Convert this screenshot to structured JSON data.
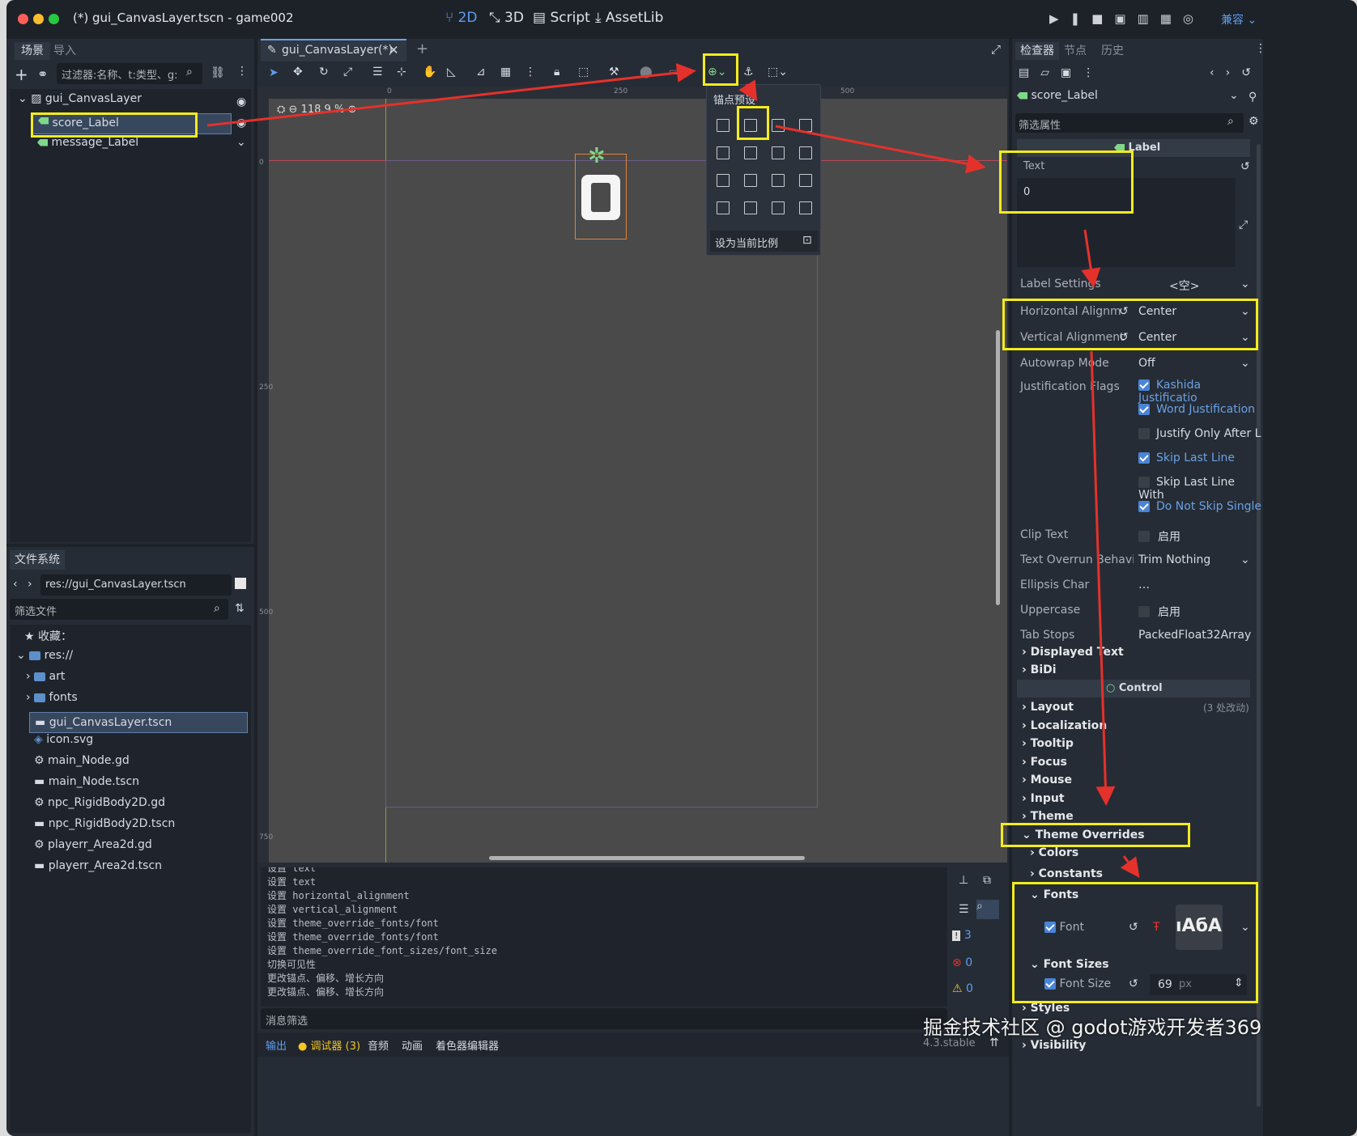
{
  "window": {
    "title": "(*) gui_CanvasLayer.tscn - game002"
  },
  "main_tabs": [
    {
      "label": "2D"
    },
    {
      "label": "3D"
    },
    {
      "label": "Script"
    },
    {
      "label": "AssetLib"
    }
  ],
  "top_right": {
    "renderer": "兼容"
  },
  "scene_dock": {
    "tabs": [
      "场景",
      "导入"
    ],
    "filter_placeholder": "过滤器:名称、t:类型、g:",
    "nodes": [
      {
        "name": "gui_CanvasLayer"
      },
      {
        "name": "score_Label"
      },
      {
        "name": "message_Label"
      }
    ]
  },
  "fs_dock": {
    "tab": "文件系统",
    "path": "res://gui_CanvasLayer.tscn",
    "filter_placeholder": "筛选文件",
    "favorites": "收藏：",
    "items": [
      "res://",
      "art",
      "fonts",
      "gui_CanvasLayer.tscn",
      "icon.svg",
      "main_Node.gd",
      "main_Node.tscn",
      "npc_RigidBody2D.gd",
      "npc_RigidBody2D.tscn",
      "playerr_Area2d.gd",
      "playerr_Area2d.tscn"
    ]
  },
  "editor": {
    "tab": "gui_CanvasLayer(*)",
    "zoom": "118.9 %",
    "ruler": [
      "0",
      "250",
      "500"
    ],
    "ruler_v": [
      "0",
      "250",
      "500",
      "750"
    ],
    "label_text": "0"
  },
  "anchor_popup": {
    "title": "锚点预设",
    "fit_label": "设为当前比例"
  },
  "output": {
    "lines": [
      "设置 text",
      "设置 text",
      "设置 horizontal_alignment",
      "设置 vertical_alignment",
      "设置 theme_override_fonts/font",
      "设置 theme_override_fonts/font",
      "设置 theme_override_font_sizes/font_size",
      "切换可见性",
      "更改锚点、偏移、增长方向",
      "更改锚点、偏移、增长方向"
    ],
    "filter_placeholder": "消息筛选",
    "counts": [
      "3",
      "0",
      "0"
    ],
    "bottom_tabs": [
      "输出",
      "调试器 (3)",
      "音频",
      "动画",
      "着色器编辑器"
    ],
    "version": "4.3.stable"
  },
  "inspector": {
    "tabs": [
      "检查器",
      "节点",
      "历史"
    ],
    "node": "score_Label",
    "filter_placeholder": "筛选属性",
    "section_label": "Label",
    "text_label": "Text",
    "text_value": "0",
    "label_settings": {
      "label": "Label Settings",
      "value": "<空>"
    },
    "props": [
      {
        "label": "Horizontal Alignm",
        "value": "Center"
      },
      {
        "label": "Vertical Alignment",
        "value": "Center"
      },
      {
        "label": "Autowrap Mode",
        "value": "Off"
      }
    ],
    "just_label": "Justification Flags",
    "flags": [
      {
        "label": "Kashida Justificatio",
        "checked": true
      },
      {
        "label": "Word Justification",
        "checked": true
      },
      {
        "label": "Justify Only After L",
        "checked": false
      },
      {
        "label": "Skip Last Line",
        "checked": true
      },
      {
        "label": "Skip Last Line With",
        "checked": false
      },
      {
        "label": "Do Not Skip Single",
        "checked": true
      }
    ],
    "props2": [
      {
        "label": "Clip Text",
        "value": "启用"
      },
      {
        "label": "Text Overrun Behavio",
        "value": "Trim Nothing"
      },
      {
        "label": "Ellipsis Char",
        "value": "…"
      },
      {
        "label": "Uppercase",
        "value": "启用"
      },
      {
        "label": "Tab Stops",
        "value": "PackedFloat32Array"
      }
    ],
    "groups1": [
      "Displayed Text",
      "BiDi"
    ],
    "control": "Control",
    "groups2": [
      "Layout",
      "Localization",
      "Tooltip",
      "Focus",
      "Mouse",
      "Input",
      "Theme"
    ],
    "layout_note": "(3 处改动)",
    "theme_overrides": "Theme Overrides",
    "sub": [
      "Colors",
      "Constants"
    ],
    "fonts": "Fonts",
    "font_label": "Font",
    "font_preview": "ıAбA",
    "font_sizes": "Font Sizes",
    "font_size_label": "Font Size",
    "font_size_value": "69",
    "font_size_unit": "px",
    "groups3": [
      "Styles",
      "Visibility"
    ]
  },
  "watermark": "掘金技术社区 @ godot游戏开发者369"
}
